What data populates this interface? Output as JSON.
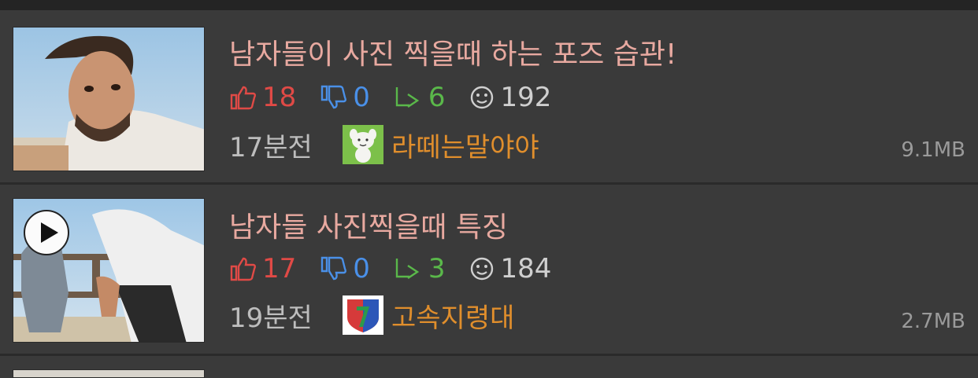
{
  "posts": [
    {
      "title": "남자들이 사진 찍을때 하는 포즈 습관!",
      "likes": "18",
      "dislikes": "0",
      "shares": "6",
      "views": "192",
      "time": "17분전",
      "author": "라떼는말야야",
      "size": "9.1MB",
      "has_video": false,
      "avatar_icon": "cartoon-animal-avatar-icon"
    },
    {
      "title": "남자들 사진찍을때 특징",
      "likes": "17",
      "dislikes": "0",
      "shares": "3",
      "views": "184",
      "time": "19분전",
      "author": "고속지령대",
      "size": "2.7MB",
      "has_video": true,
      "avatar_icon": "shield-emblem-avatar-icon"
    }
  ],
  "colors": {
    "background": "#3a3a3a",
    "title": "#e8a9a0",
    "likes": "#e04a46",
    "dislikes": "#4a90e8",
    "shares": "#5ab84a",
    "author": "#e08e2c"
  }
}
